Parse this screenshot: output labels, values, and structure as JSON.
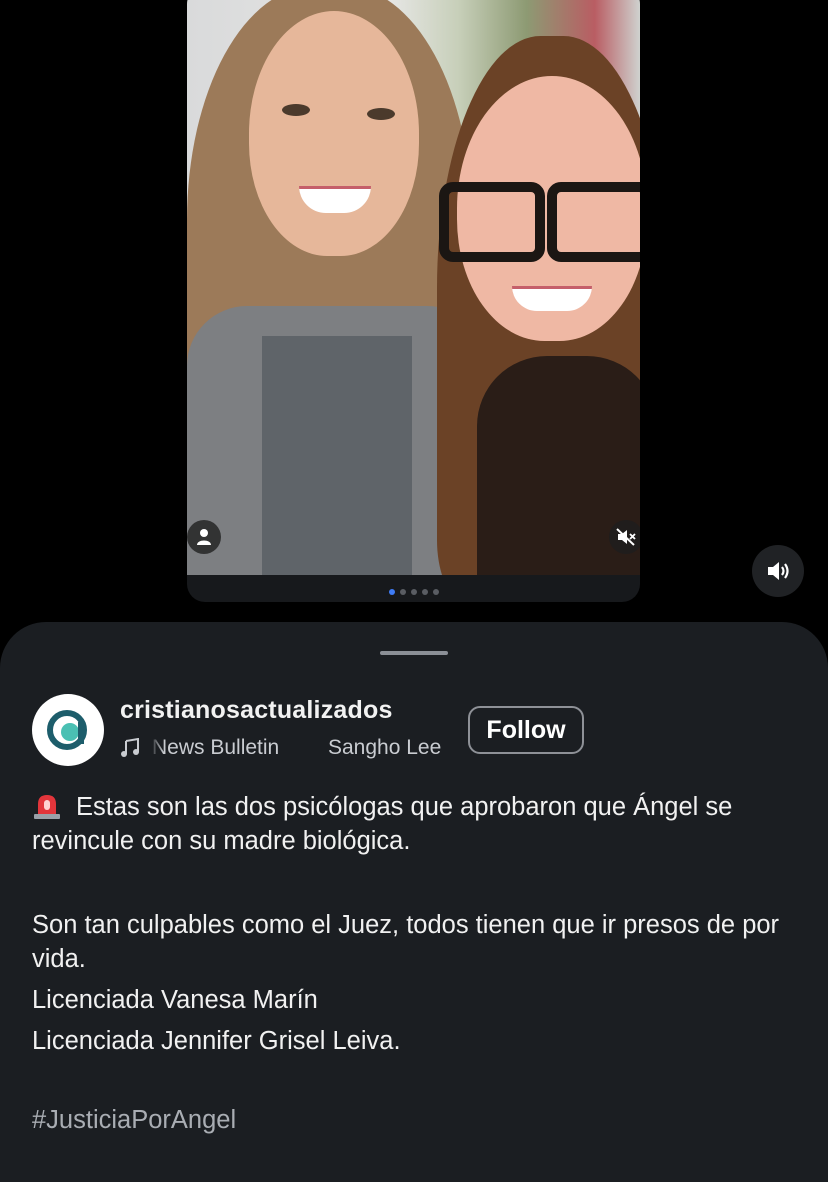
{
  "post": {
    "username": "cristianosactualizados",
    "music": {
      "track_primary": "News Bulletin",
      "track_secondary": "Sangho Lee"
    },
    "follow_label": "Follow",
    "caption": {
      "line1": "Estas son las dos psicólogas que aprobaron que Ángel se revincule con su madre biológica.",
      "line2": "Son tan culpables como el Juez, todos tienen que ir presos de por vida.",
      "line3": "Licenciada Vanesa Marín",
      "line4": "Licenciada Jennifer Grisel Leiva."
    },
    "hashtag": "#JusticiaPorAngel"
  },
  "carousel": {
    "total": 5,
    "active_index": 1
  },
  "icons": {
    "tagged_people": "person-icon",
    "muted": "speaker-muted-icon",
    "volume": "speaker-icon",
    "music": "music-note-icon",
    "alert": "siren-icon"
  },
  "colors": {
    "sheet_bg": "#1b1e22",
    "accent_dot": "#3f7cf6",
    "background": "#000000"
  }
}
